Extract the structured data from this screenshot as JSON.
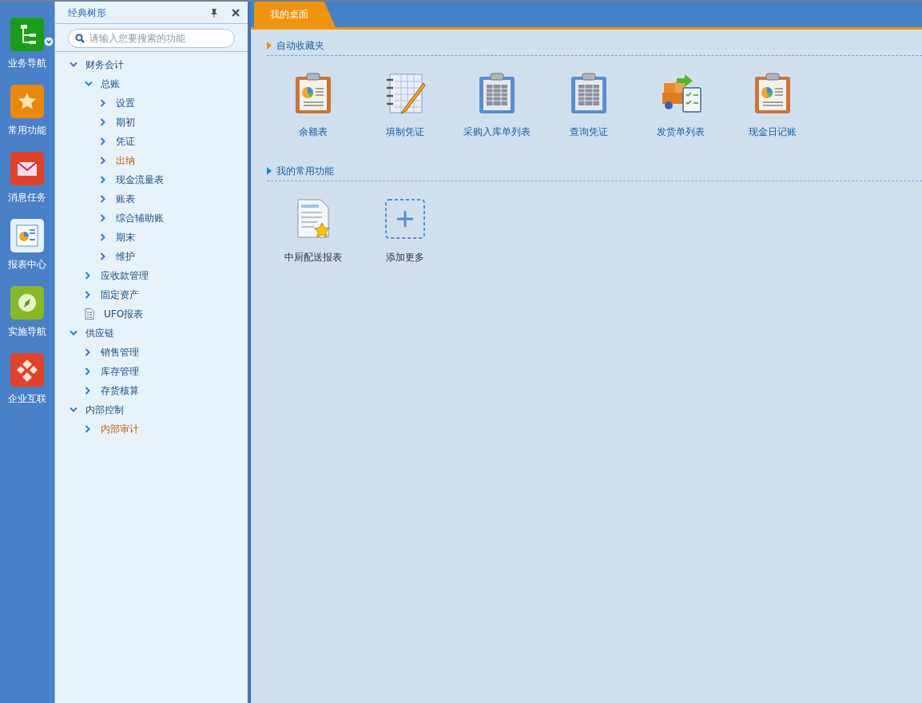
{
  "rail": [
    {
      "label": "业务导航",
      "kind": "nav",
      "dropdown": true
    },
    {
      "label": "常用功能",
      "kind": "star",
      "dropdown": false
    },
    {
      "label": "消息任务",
      "kind": "mail",
      "dropdown": false
    },
    {
      "label": "报表中心",
      "kind": "report",
      "dropdown": false
    },
    {
      "label": "实施导航",
      "kind": "compass",
      "dropdown": false
    },
    {
      "label": "企业互联",
      "kind": "link",
      "dropdown": false
    }
  ],
  "tree_panel": {
    "title": "经典树形",
    "search": {
      "placeholder": "请输入您要搜索的功能"
    },
    "items": [
      {
        "label": "财务会计",
        "kind": "folder",
        "expanded": true,
        "highlighted": false,
        "children": [
          {
            "label": "总账",
            "kind": "folder",
            "expanded": true,
            "highlighted": false,
            "children": [
              {
                "label": "设置",
                "kind": "folder",
                "expanded": false,
                "highlighted": false
              },
              {
                "label": "期初",
                "kind": "folder",
                "expanded": false,
                "highlighted": false
              },
              {
                "label": "凭证",
                "kind": "folder",
                "expanded": false,
                "highlighted": false
              },
              {
                "label": "出纳",
                "kind": "folder",
                "expanded": false,
                "highlighted": true
              },
              {
                "label": "现金流量表",
                "kind": "folder",
                "expanded": false,
                "highlighted": false
              },
              {
                "label": "账表",
                "kind": "folder",
                "expanded": false,
                "highlighted": false
              },
              {
                "label": "综合辅助账",
                "kind": "folder",
                "expanded": false,
                "highlighted": false
              },
              {
                "label": "期末",
                "kind": "folder",
                "expanded": false,
                "highlighted": false
              },
              {
                "label": "维护",
                "kind": "folder",
                "expanded": false,
                "highlighted": false
              }
            ]
          },
          {
            "label": "应收款管理",
            "kind": "folder",
            "expanded": false,
            "highlighted": false
          },
          {
            "label": "固定资产",
            "kind": "folder",
            "expanded": false,
            "highlighted": false
          },
          {
            "label": "UFO报表",
            "kind": "document",
            "expanded": false,
            "highlighted": false
          }
        ]
      },
      {
        "label": "供应链",
        "kind": "folder",
        "expanded": true,
        "highlighted": false,
        "children": [
          {
            "label": "销售管理",
            "kind": "folder",
            "expanded": false,
            "highlighted": false
          },
          {
            "label": "库存管理",
            "kind": "folder",
            "expanded": false,
            "highlighted": false
          },
          {
            "label": "存货核算",
            "kind": "folder",
            "expanded": false,
            "highlighted": false
          }
        ]
      },
      {
        "label": "内部控制",
        "kind": "folder",
        "expanded": true,
        "highlighted": false,
        "children": [
          {
            "label": "内部审计",
            "kind": "folder",
            "expanded": false,
            "highlighted": true
          }
        ]
      }
    ]
  },
  "tabs": [
    {
      "label": "我的桌面",
      "selected": true
    }
  ],
  "sections": [
    {
      "title": "自动收藏夹",
      "color": "#f08c00",
      "kind": "auto",
      "shortcuts": [
        {
          "label": "余额表",
          "kind": "clipboard-chart"
        },
        {
          "label": "填制凭证",
          "kind": "notebook"
        },
        {
          "label": "采购入库单列表",
          "kind": "clipboard-table"
        },
        {
          "label": "查询凭证",
          "kind": "clipboard-table"
        },
        {
          "label": "发货单列表",
          "kind": "delivery"
        },
        {
          "label": "现金日记账",
          "kind": "clipboard-chart"
        }
      ]
    },
    {
      "title": "我的常用功能",
      "color": "#1e88e5",
      "kind": "custom",
      "shortcuts": [
        {
          "label": "中厨配送报表",
          "kind": "doc-star"
        },
        {
          "label": "添加更多",
          "kind": "add"
        }
      ]
    }
  ]
}
